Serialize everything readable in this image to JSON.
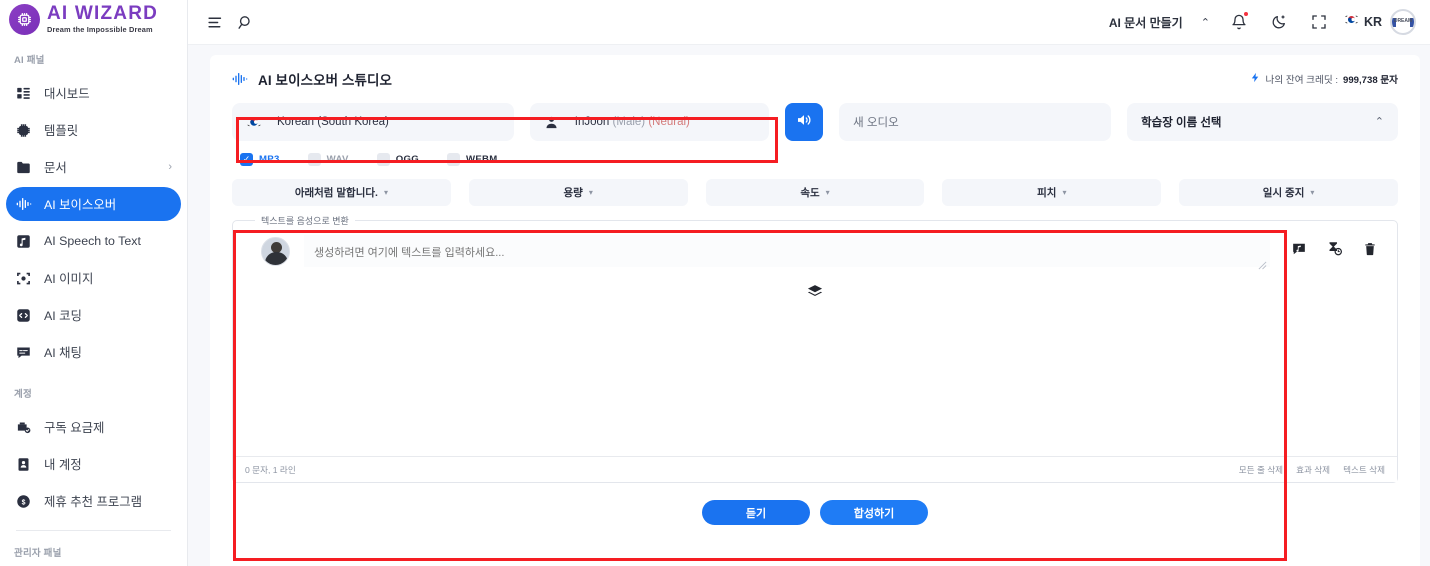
{
  "brand": {
    "title": "AI WIZARD",
    "tagline": "Dream the Impossible Dream",
    "logo_icon": "chip-icon"
  },
  "sidebar": {
    "section_ai": "AI 패널",
    "section_account": "계정",
    "section_admin": "관리자 패널",
    "items": [
      {
        "label": "대시보드",
        "icon": "dashboard-icon",
        "active": false,
        "chevron": ""
      },
      {
        "label": "템플릿",
        "icon": "chip-template-icon",
        "active": false,
        "chevron": ""
      },
      {
        "label": "문서",
        "icon": "folder-icon",
        "active": false,
        "chevron": "›"
      },
      {
        "label": "AI 보이스오버",
        "icon": "waveform-icon",
        "active": true,
        "chevron": ""
      },
      {
        "label": "AI Speech to Text",
        "icon": "music-note-icon",
        "active": false,
        "chevron": ""
      },
      {
        "label": "AI 이미지",
        "icon": "image-frame-icon",
        "active": false,
        "chevron": ""
      },
      {
        "label": "AI 코딩",
        "icon": "code-icon",
        "active": false,
        "chevron": ""
      },
      {
        "label": "AI 채팅",
        "icon": "chat-icon",
        "active": false,
        "chevron": ""
      }
    ],
    "account_items": [
      {
        "label": "구독 요금제",
        "icon": "subscription-icon"
      },
      {
        "label": "내 계정",
        "icon": "id-card-icon"
      },
      {
        "label": "제휴 추천 프로그램",
        "icon": "dollar-coin-icon"
      }
    ]
  },
  "topbar": {
    "menu_icon": "hamburger-menu-icon",
    "search_icon": "search-icon",
    "create_doc_label": "AI 문서 만들기",
    "caret": "⌃",
    "bell_icon": "bell-icon",
    "theme_icon": "moon-icon",
    "fullscreen_icon": "fullscreen-icon",
    "lang_code": "KR",
    "flag_icon": "korea-flag-icon",
    "avatar_text": "DREAM"
  },
  "panel": {
    "title": "AI 보이스오버 스튜디오",
    "title_icon": "waveform-icon",
    "credit_icon": "lightning-icon",
    "credit_label": "나의 잔여 크레딧 : ",
    "credit_value": "999,738 문자"
  },
  "selectors": {
    "language": {
      "value": "Korean (South Korea)",
      "icon": "korea-flag-icon",
      "caret": "⌃"
    },
    "voice": {
      "name": "InJoon",
      "gender": "(Male)",
      "type": "(Neural)",
      "icon": "person-icon",
      "caret": "⌃"
    },
    "speaker_button": {
      "icon": "speaker-icon"
    },
    "audio_name": {
      "placeholder": "새 오디오",
      "value": ""
    },
    "project": {
      "value": "학습장 이름 선택",
      "caret": "⌃"
    }
  },
  "formats": [
    {
      "label": "MP3",
      "checked": true,
      "style": "on"
    },
    {
      "label": "WAV",
      "checked": false,
      "style": "muted"
    },
    {
      "label": "OGG",
      "checked": false,
      "style": "dark"
    },
    {
      "label": "WEBM",
      "checked": false,
      "style": "dark"
    }
  ],
  "effects": [
    {
      "label": "아래처럼 말합니다.",
      "caret": "▾"
    },
    {
      "label": "용량",
      "caret": "▾"
    },
    {
      "label": "속도",
      "caret": "▾"
    },
    {
      "label": "피치",
      "caret": "▾"
    },
    {
      "label": "일시 중지",
      "caret": "▾"
    }
  ],
  "editor": {
    "legend": "텍스트를 음성으로 변환",
    "placeholder": "생성하려면 여기에 텍스트를 입력하세요...",
    "value": "",
    "avatar_icon": "user-avatar-icon",
    "tools": [
      {
        "icon": "sound-bubble-icon"
      },
      {
        "icon": "timer-icon"
      },
      {
        "icon": "trash-icon"
      }
    ],
    "center_icon": "layers-icon",
    "status_left": "0 문자, 1 라인",
    "footer_links": [
      "모든 줄 삭제",
      "효과 삭제",
      "텍스트 삭제"
    ]
  },
  "actions": {
    "listen_label": "듣기",
    "synthesize_label": "합성하기"
  },
  "colors": {
    "accent": "#1a73f0",
    "brand_purple": "#7b3cc0",
    "annotation_red": "#f51d22",
    "panel_bg": "#f7f8fb",
    "field_bg": "#f4f6fa"
  }
}
